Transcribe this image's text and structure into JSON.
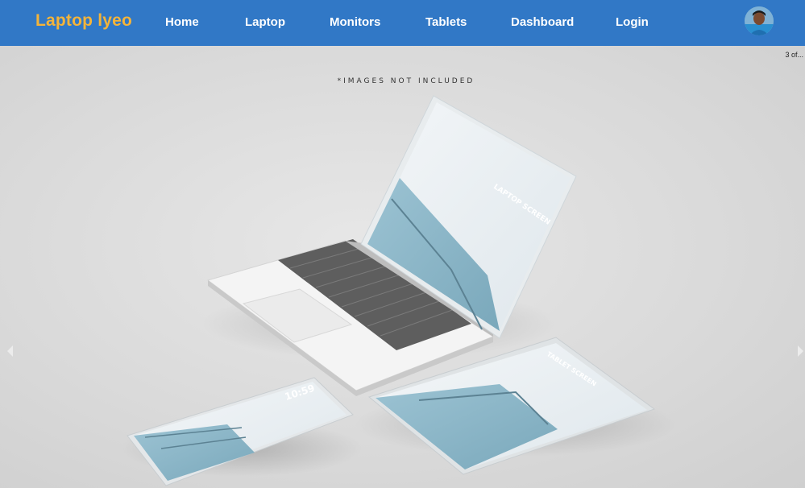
{
  "navbar": {
    "brand": "Laptop lyeo",
    "links": [
      "Home",
      "Laptop",
      "Monitors",
      "Tablets",
      "Dashboard",
      "Login"
    ],
    "brand_color": "#f4b43a",
    "bar_color": "#3178c6"
  },
  "carousel": {
    "counter": "3 of...",
    "slide_caption": "*IMAGES NOT INCLUDED",
    "laptop_screen_label": "LAPTOP SCREEN",
    "tablet_screen_label": "TABLET SCREEN",
    "phone_time": "10:59",
    "prev_icon": "chevron-left-icon",
    "next_icon": "chevron-right-icon"
  }
}
